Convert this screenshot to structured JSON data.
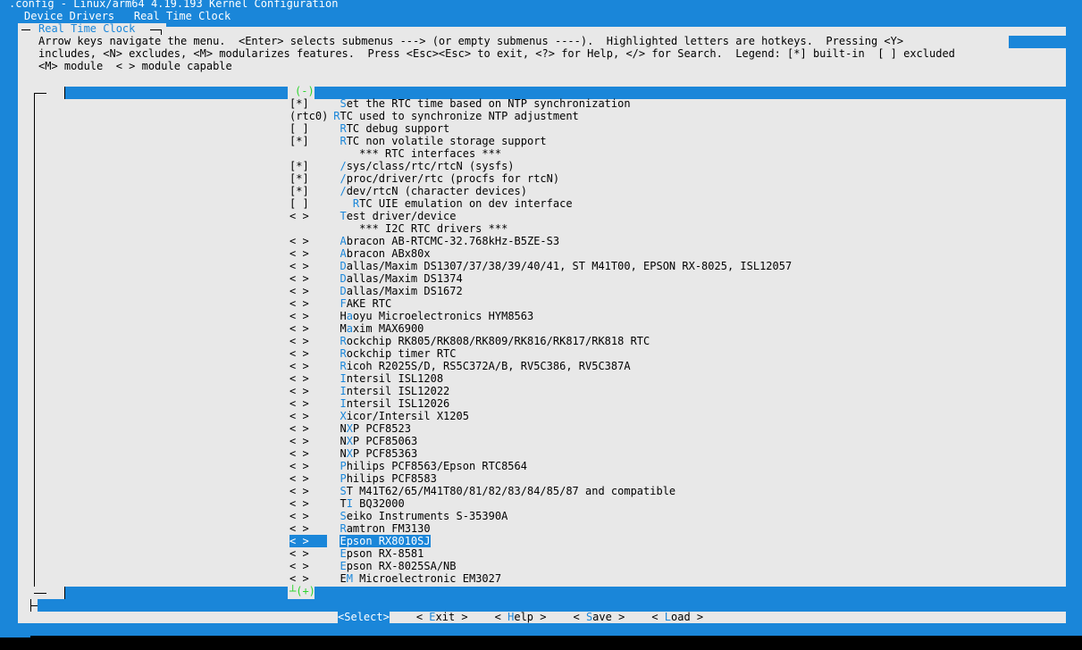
{
  "window_title": ".config - Linux/arm64 4.19.193 Kernel Configuration",
  "breadcrumb": {
    "parent": "Device Drivers",
    "current": "Real Time Clock"
  },
  "dialog_title": "Real Time Clock",
  "help_lines": [
    "Arrow keys navigate the menu.  <Enter> selects submenus ---> (or empty submenus ----).  Highlighted letters are hotkeys.  Pressing <Y>",
    "includes, <N> excludes, <M> modularizes features.  Press <Esc><Esc> to exit, <?> for Help, </> for Search.  Legend: [*] built-in  [ ] excluded",
    "<M> module  < > module capable"
  ],
  "scroll_up_indicator": "(-)",
  "scroll_down_indicator": "(+)",
  "menu_items": [
    {
      "state": "[*]",
      "indent": "  ",
      "hot": "S",
      "rest": "et the RTC time based on NTP synchronization",
      "selected": false
    },
    {
      "state": "(rtc0)",
      "indent": " ",
      "hot": "R",
      "rest": "TC used to synchronize NTP adjustment",
      "selected": false
    },
    {
      "state": "[ ]",
      "indent": "  ",
      "hot": "R",
      "rest": "TC debug support",
      "selected": false
    },
    {
      "state": "[*]",
      "indent": "  ",
      "hot": "R",
      "rest": "TC non volatile storage support",
      "selected": false
    },
    {
      "state": "",
      "indent": "     ",
      "hot": "",
      "rest": "*** RTC interfaces ***",
      "selected": false
    },
    {
      "state": "[*]",
      "indent": "  ",
      "hot": "/",
      "rest": "sys/class/rtc/rtcN (sysfs)",
      "selected": false
    },
    {
      "state": "[*]",
      "indent": "  ",
      "hot": "/",
      "rest": "proc/driver/rtc (procfs for rtcN)",
      "selected": false
    },
    {
      "state": "[*]",
      "indent": "  ",
      "hot": "/",
      "rest": "dev/rtcN (character devices)",
      "selected": false
    },
    {
      "state": "[ ]",
      "indent": "    ",
      "hot": "R",
      "rest": "TC UIE emulation on dev interface",
      "selected": false
    },
    {
      "state": "< >",
      "indent": "  ",
      "hot": "T",
      "rest": "est driver/device",
      "selected": false
    },
    {
      "state": "",
      "indent": "     ",
      "hot": "",
      "rest": "*** I2C RTC drivers ***",
      "selected": false
    },
    {
      "state": "< >",
      "indent": "  ",
      "hot": "A",
      "rest": "bracon AB-RTCMC-32.768kHz-B5ZE-S3",
      "selected": false
    },
    {
      "state": "< >",
      "indent": "  ",
      "hot": "A",
      "rest": "bracon ABx80x",
      "selected": false
    },
    {
      "state": "< >",
      "indent": "  ",
      "hot": "D",
      "rest": "allas/Maxim DS1307/37/38/39/40/41, ST M41T00, EPSON RX-8025, ISL12057",
      "selected": false
    },
    {
      "state": "< >",
      "indent": "  ",
      "hot": "D",
      "rest": "allas/Maxim DS1374",
      "selected": false
    },
    {
      "state": "< >",
      "indent": "  ",
      "hot": "D",
      "rest": "allas/Maxim DS1672",
      "selected": false
    },
    {
      "state": "< >",
      "indent": "  ",
      "hot": "F",
      "rest": "AKE RTC",
      "selected": false
    },
    {
      "state": "< >",
      "indent": "  ",
      "pre": "H",
      "hot": "a",
      "rest": "oyu Microelectronics HYM8563",
      "selected": false
    },
    {
      "state": "< >",
      "indent": "  ",
      "pre": "M",
      "hot": "a",
      "rest": "xim MAX6900",
      "selected": false
    },
    {
      "state": "< >",
      "indent": "  ",
      "hot": "R",
      "rest": "ockchip RK805/RK808/RK809/RK816/RK817/RK818 RTC",
      "selected": false
    },
    {
      "state": "< >",
      "indent": "  ",
      "hot": "R",
      "rest": "ockchip timer RTC",
      "selected": false
    },
    {
      "state": "< >",
      "indent": "  ",
      "hot": "R",
      "rest": "icoh R2025S/D, RS5C372A/B, RV5C386, RV5C387A",
      "selected": false
    },
    {
      "state": "< >",
      "indent": "  ",
      "hot": "I",
      "rest": "ntersil ISL1208",
      "selected": false
    },
    {
      "state": "< >",
      "indent": "  ",
      "hot": "I",
      "rest": "ntersil ISL12022",
      "selected": false
    },
    {
      "state": "< >",
      "indent": "  ",
      "hot": "I",
      "rest": "ntersil ISL12026",
      "selected": false
    },
    {
      "state": "< >",
      "indent": "  ",
      "hot": "X",
      "rest": "icor/Intersil X1205",
      "selected": false
    },
    {
      "state": "< >",
      "indent": "  ",
      "pre": "N",
      "hot": "X",
      "rest": "P PCF8523",
      "selected": false
    },
    {
      "state": "< >",
      "indent": "  ",
      "pre": "N",
      "hot": "X",
      "rest": "P PCF85063",
      "selected": false
    },
    {
      "state": "< >",
      "indent": "  ",
      "pre": "N",
      "hot": "X",
      "rest": "P PCF85363",
      "selected": false
    },
    {
      "state": "< >",
      "indent": "  ",
      "hot": "P",
      "rest": "hilips PCF8563/Epson RTC8564",
      "selected": false
    },
    {
      "state": "< >",
      "indent": "  ",
      "hot": "P",
      "rest": "hilips PCF8583",
      "selected": false
    },
    {
      "state": "< >",
      "indent": "  ",
      "hot": "S",
      "rest": "T M41T62/65/M41T80/81/82/83/84/85/87 and compatible",
      "selected": false
    },
    {
      "state": "< >",
      "indent": "  ",
      "pre": "T",
      "hot": "I",
      "rest": " BQ32000",
      "selected": false
    },
    {
      "state": "< >",
      "indent": "  ",
      "hot": "S",
      "rest": "eiko Instruments S-35390A",
      "selected": false
    },
    {
      "state": "< >",
      "indent": "  ",
      "hot": "R",
      "rest": "amtron FM3130",
      "selected": false
    },
    {
      "state": "< >",
      "indent": "  ",
      "hot": "E",
      "rest": "pson RX8010SJ",
      "selected": true
    },
    {
      "state": "< >",
      "indent": "  ",
      "hot": "E",
      "rest": "pson RX-8581",
      "selected": false
    },
    {
      "state": "< >",
      "indent": "  ",
      "hot": "E",
      "rest": "pson RX-8025SA/NB",
      "selected": false
    },
    {
      "state": "< >",
      "indent": "  ",
      "pre": "E",
      "hot": "M",
      "rest": " Microelectronic EM3027",
      "selected": false
    }
  ],
  "buttons": [
    {
      "open": "<",
      "hot": "S",
      "rest": "elect",
      "close": ">",
      "selected": true
    },
    {
      "open": "< ",
      "hot": "E",
      "rest": "xit",
      "close": " >",
      "selected": false
    },
    {
      "open": "< ",
      "hot": "H",
      "rest": "elp",
      "close": " >",
      "selected": false
    },
    {
      "open": "< ",
      "hot": "S",
      "rest": "ave",
      "close": " >",
      "selected": false
    },
    {
      "open": "< ",
      "hot": "L",
      "rest": "oad",
      "close": " >",
      "selected": false
    }
  ],
  "colors": {
    "background": "#1a86d9",
    "dialog": "#e8e8e8",
    "hotkey": "#1a86d9",
    "selected_bg": "#1a86d9",
    "indicator": "#2fd42f"
  }
}
